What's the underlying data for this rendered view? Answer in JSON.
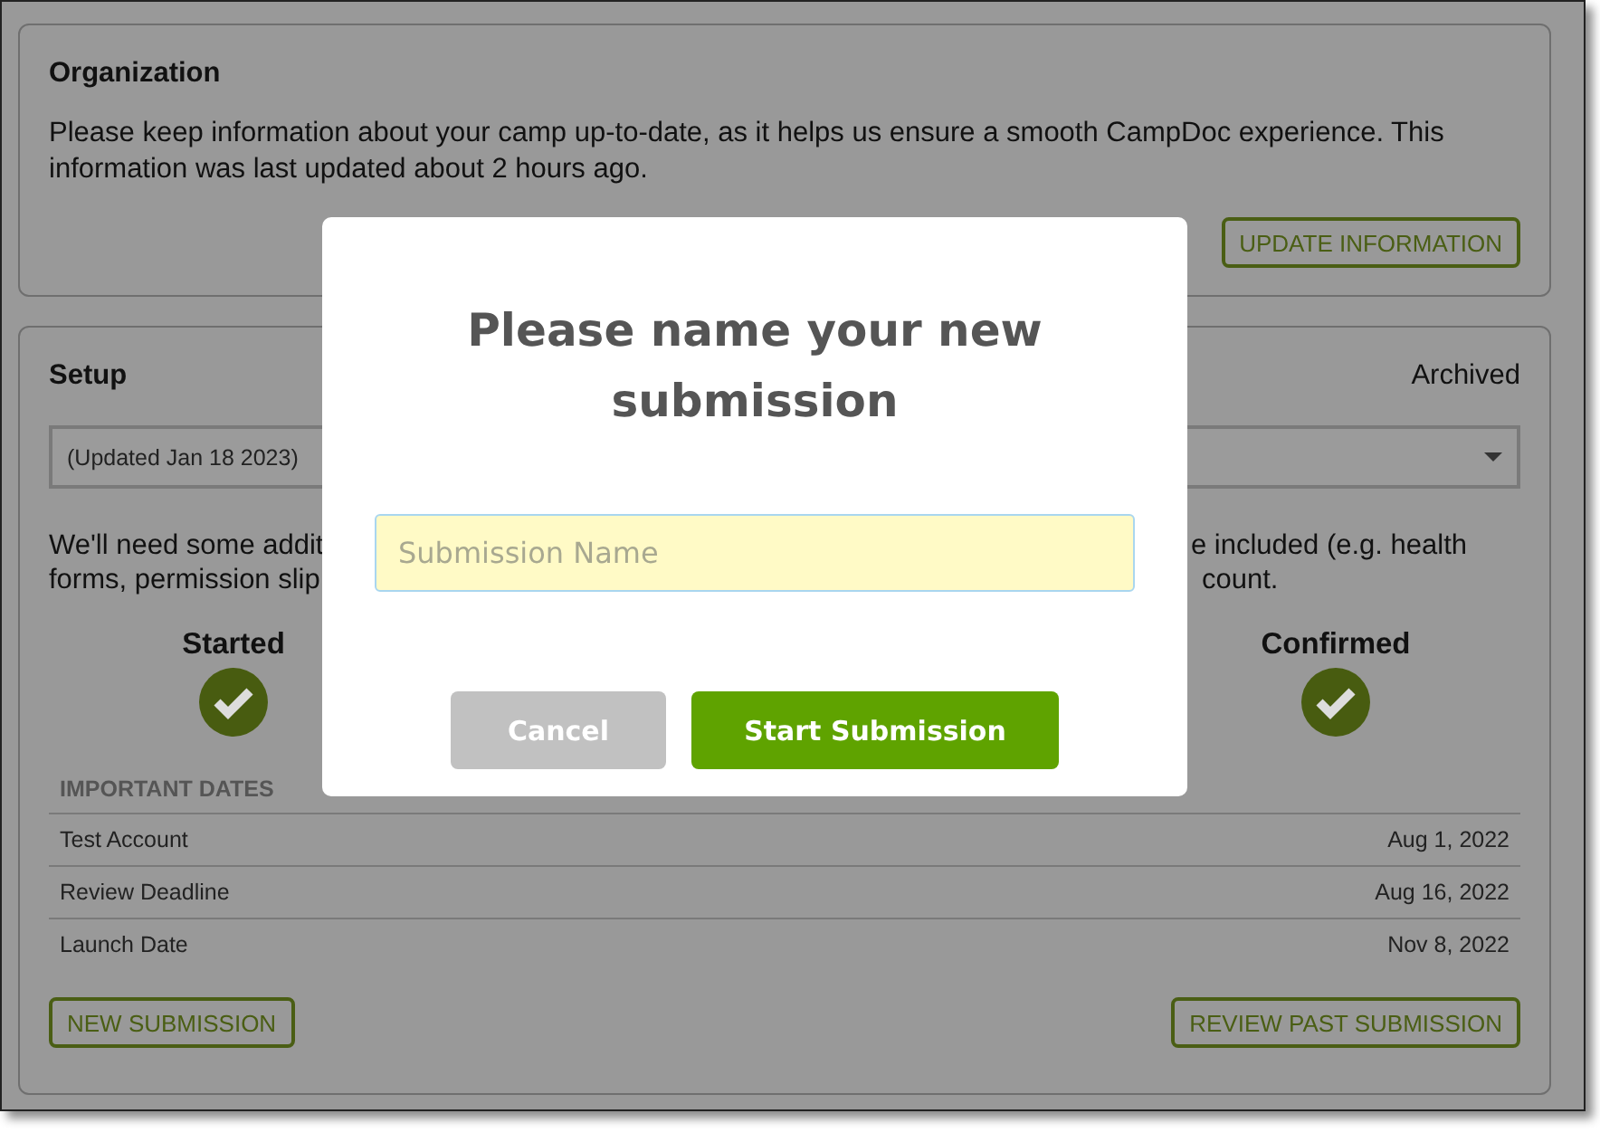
{
  "organization": {
    "title": "Organization",
    "description": "Please keep information about your camp up-to-date, as it helps us ensure a smooth CampDoc experience. This information was last updated about 2 hours ago.",
    "button": "UPDATE INFORMATION"
  },
  "setup": {
    "title": "Setup",
    "status": "Archived",
    "dropdown": {
      "value": "(Updated Jan 18 2023)"
    },
    "description_left": [
      "We'll need some addit",
      "forms, permission slip"
    ],
    "description_right": [
      "e included (e.g. health",
      "count."
    ],
    "steps": [
      {
        "label": "Started",
        "done": true
      },
      {
        "label": "Confirmed",
        "done": true
      }
    ],
    "important_dates": {
      "heading": "IMPORTANT DATES",
      "rows": [
        {
          "label": "Test Account",
          "date": "Aug 1, 2022"
        },
        {
          "label": "Review Deadline",
          "date": "Aug 16, 2022"
        },
        {
          "label": "Launch Date",
          "date": "Nov 8, 2022"
        }
      ]
    },
    "buttons": [
      "NEW SUBMISSION",
      "REVIEW PAST SUBMISSION"
    ]
  },
  "dialog": {
    "title": "Please name your new submission",
    "field": {
      "placeholder": "Submission Name"
    },
    "buttons": [
      {
        "label": "Cancel",
        "kind": "secondary"
      },
      {
        "label": "Start Submission",
        "kind": "primary"
      }
    ]
  }
}
